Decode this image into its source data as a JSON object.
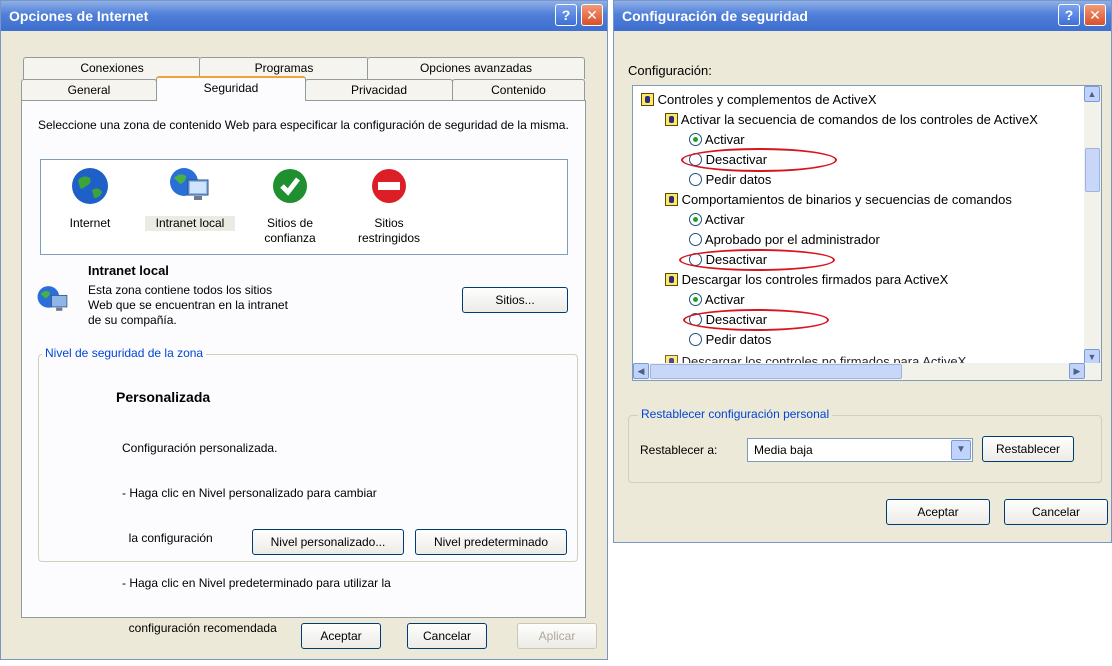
{
  "left_window": {
    "title": "Opciones de Internet",
    "help_glyph": "?",
    "close_glyph": "✕",
    "tabs_back": [
      "Conexiones",
      "Programas",
      "Opciones avanzadas"
    ],
    "tabs_front": [
      "General",
      "Seguridad",
      "Privacidad",
      "Contenido"
    ],
    "active_tab": "Seguridad",
    "instruction": "Seleccione una zona de contenido Web para especificar la configuración de seguridad de la misma.",
    "zones": [
      {
        "label": "Internet",
        "icon": "globe-icon"
      },
      {
        "label": "Intranet local",
        "icon": "intranet-icon"
      },
      {
        "label": "Sitios de confianza",
        "icon": "check-icon"
      },
      {
        "label": "Sitios restringidos",
        "icon": "no-entry-icon"
      }
    ],
    "zone_title": "Intranet local",
    "zone_desc_lines": [
      "Esta zona contiene todos los sitios",
      "Web que se encuentran en la intranet",
      "de su compañía."
    ],
    "sites_button": "Sitios...",
    "group_label": "Nivel de seguridad de la zona",
    "level_title": "Personalizada",
    "level_lines": [
      "Configuración personalizada.",
      "- Haga clic en Nivel personalizado para cambiar",
      "  la configuración",
      "- Haga clic en Nivel predeterminado para utilizar la",
      "  configuración recomendada"
    ],
    "custom_level_button": "Nivel personalizado...",
    "default_level_button": "Nivel predeterminado",
    "ok_button": "Aceptar",
    "cancel_button": "Cancelar",
    "apply_button": "Aplicar"
  },
  "right_window": {
    "title": "Configuración de seguridad",
    "help_glyph": "?",
    "close_glyph": "✕",
    "settings_label": "Configuración:",
    "tree": [
      {
        "type": "category",
        "text": "Controles y complementos de ActiveX"
      },
      {
        "type": "setting",
        "text": "Activar la secuencia de comandos de los controles de ActiveX"
      },
      {
        "type": "option",
        "text": "Activar",
        "selected": true
      },
      {
        "type": "option",
        "text": "Desactivar",
        "selected": false
      },
      {
        "type": "option",
        "text": "Pedir datos",
        "selected": false
      },
      {
        "type": "setting",
        "text": "Comportamientos de binarios y secuencias de comandos"
      },
      {
        "type": "option",
        "text": "Activar",
        "selected": true
      },
      {
        "type": "option",
        "text": "Aprobado por el administrador",
        "selected": false
      },
      {
        "type": "option",
        "text": "Desactivar",
        "selected": false
      },
      {
        "type": "setting",
        "text": "Descargar los controles firmados para ActiveX"
      },
      {
        "type": "option",
        "text": "Activar",
        "selected": true
      },
      {
        "type": "option",
        "text": "Desactivar",
        "selected": false
      },
      {
        "type": "option",
        "text": "Pedir datos",
        "selected": false
      },
      {
        "type": "setting",
        "text": "Descargar los controles no firmados para ActiveX"
      }
    ],
    "reset_group_label": "Restablecer configuración personal",
    "reset_to_label": "Restablecer a:",
    "reset_select_value": "Media baja",
    "reset_button": "Restablecer",
    "ok_button": "Aceptar",
    "cancel_button": "Cancelar"
  },
  "colors": {
    "title_blue": "#3f6fcf",
    "highlight_red": "#d8141c",
    "group_label_blue": "#0046d5"
  }
}
